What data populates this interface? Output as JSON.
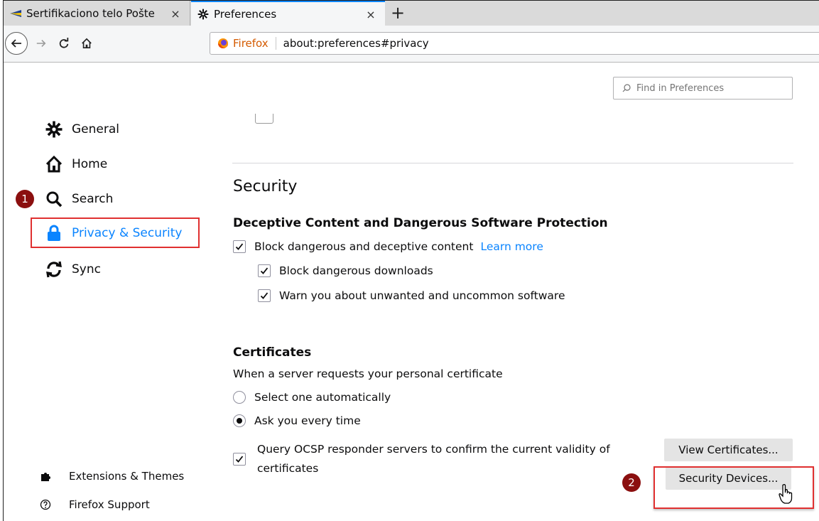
{
  "tabs": [
    {
      "label": "Sertifikaciono telo Pošte",
      "close": "×",
      "icon": "flag-icon"
    },
    {
      "label": "Preferences",
      "close": "×",
      "icon": "gear-icon"
    }
  ],
  "newtab_label": "+",
  "urlbar": {
    "identity": "Firefox",
    "url": "about:preferences#privacy"
  },
  "search": {
    "placeholder": "Find in Preferences"
  },
  "sidebar": {
    "items": [
      {
        "label": "General",
        "icon": "gear-icon"
      },
      {
        "label": "Home",
        "icon": "home-icon"
      },
      {
        "label": "Search",
        "icon": "search-icon"
      },
      {
        "label": "Privacy & Security",
        "icon": "lock-icon"
      },
      {
        "label": "Sync",
        "icon": "sync-icon"
      }
    ],
    "footer": [
      {
        "label": "Extensions & Themes",
        "icon": "puzzle-icon"
      },
      {
        "label": "Firefox Support",
        "icon": "help-icon"
      }
    ]
  },
  "annotations": {
    "badge1": "1",
    "badge2": "2"
  },
  "security": {
    "title": "Security",
    "dcp_heading": "Deceptive Content and Dangerous Software Protection",
    "block_label": "Block dangerous and deceptive content",
    "learn_more": "Learn more",
    "downloads_label": "Block dangerous downloads",
    "warn_label": "Warn you about unwanted and uncommon software"
  },
  "certificates": {
    "heading": "Certificates",
    "desc": "When a server requests your personal certificate",
    "auto_label": "Select one automatically",
    "ask_label": "Ask you every time",
    "ocsp_label": "Query OCSP responder servers to confirm the current validity of certificates",
    "view_button": "View Certificates...",
    "devices_button": "Security Devices..."
  },
  "colors": {
    "accent": "#0a84ff",
    "highlight": "#e03030",
    "badge": "#8b0f0f"
  }
}
